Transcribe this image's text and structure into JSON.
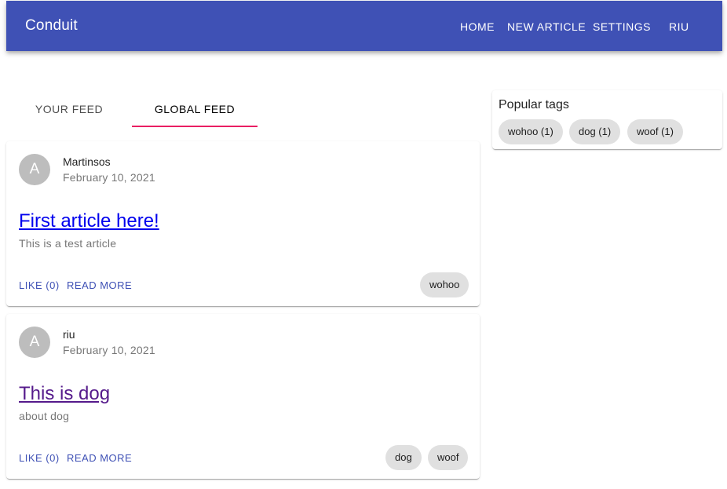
{
  "header": {
    "brand": "Conduit",
    "nav": {
      "home": "HOME",
      "new_article": "NEW ARTICLE",
      "settings": "SETTINGS",
      "user": "RIU"
    }
  },
  "feed_tabs": {
    "your_feed": "YOUR FEED",
    "global_feed": "GLOBAL FEED",
    "active": "GLOBAL FEED"
  },
  "articles": [
    {
      "avatar_letter": "A",
      "author": "Martinsos",
      "date": "February 10, 2021",
      "title": "First article here!",
      "description": "This is a test article",
      "like_label": "LIKE (0)",
      "read_more_label": "READ MORE",
      "tags": [
        "wohoo"
      ]
    },
    {
      "avatar_letter": "A",
      "author": "riu",
      "date": "February 10, 2021",
      "title": "This is dog",
      "description": "about dog",
      "like_label": "LIKE (0)",
      "read_more_label": "READ MORE",
      "tags": [
        "dog",
        "woof"
      ]
    }
  ],
  "popular_tags": {
    "title": "Popular tags",
    "tags": [
      "wohoo (1)",
      "dog (1)",
      "woof (1)"
    ]
  },
  "colors": {
    "primary": "#3f51b5",
    "tab_indicator": "#e91e63",
    "chip_bg": "#e0e0e0",
    "avatar_bg": "#bdbdbd",
    "link": "#0000ee",
    "link_visited": "#551a8b"
  }
}
